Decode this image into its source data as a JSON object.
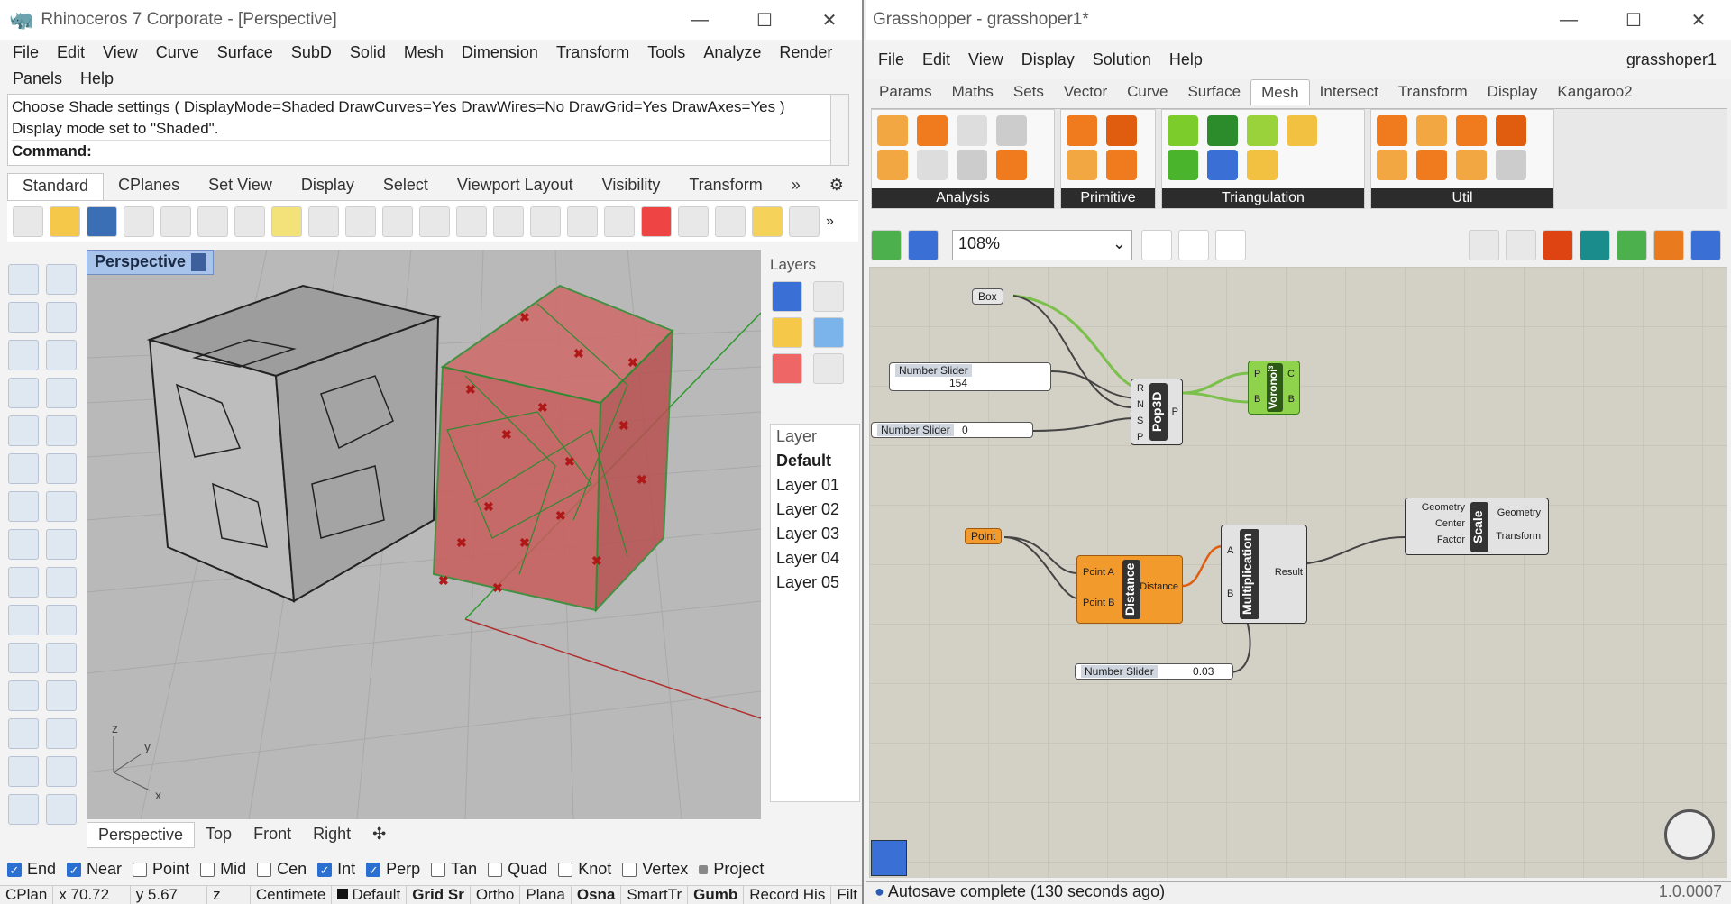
{
  "rhino": {
    "title": "Rhinoceros 7 Corporate - [Perspective]",
    "menu": [
      "File",
      "Edit",
      "View",
      "Curve",
      "Surface",
      "SubD",
      "Solid",
      "Mesh",
      "Dimension",
      "Transform",
      "Tools",
      "Analyze",
      "Render",
      "Panels",
      "Help"
    ],
    "cmd_history": [
      "Choose Shade settings ( DisplayMode=Shaded  DrawCurves=Yes  DrawWires=No  DrawGrid=Yes  DrawAxes=Yes )",
      "Display mode set to \"Shaded\"."
    ],
    "cmd_prompt": "Command:",
    "toolbar_tabs": [
      "Standard",
      "CPlanes",
      "Set View",
      "Display",
      "Select",
      "Viewport Layout",
      "Visibility",
      "Transform"
    ],
    "viewport_title": "Perspective",
    "viewport_tabs": [
      "Perspective",
      "Top",
      "Front",
      "Right"
    ],
    "axis_labels": {
      "z": "z",
      "y": "y",
      "x": "x"
    },
    "layers": {
      "panel_title": "Layers",
      "header": "Layer",
      "items": [
        "Default",
        "Layer 01",
        "Layer 02",
        "Layer 03",
        "Layer 04",
        "Layer 05"
      ]
    },
    "osnaps": [
      {
        "label": "End",
        "on": true
      },
      {
        "label": "Near",
        "on": true
      },
      {
        "label": "Point",
        "on": false
      },
      {
        "label": "Mid",
        "on": false
      },
      {
        "label": "Cen",
        "on": false
      },
      {
        "label": "Int",
        "on": true
      },
      {
        "label": "Perp",
        "on": true
      },
      {
        "label": "Tan",
        "on": false
      },
      {
        "label": "Quad",
        "on": false
      },
      {
        "label": "Knot",
        "on": false
      },
      {
        "label": "Vertex",
        "on": false
      },
      {
        "label": "Project",
        "on": false
      }
    ],
    "status": [
      "CPlan",
      "x 70.72",
      "y 5.67",
      "z",
      "Centimete",
      "Default",
      "Grid Sr",
      "Ortho",
      "Plana",
      "Osna",
      "SmartTr",
      "Gumb",
      "Record His",
      "Filt"
    ]
  },
  "gh": {
    "title": "Grasshopper - grasshoper1*",
    "doc_name": "grasshoper1",
    "menu": [
      "File",
      "Edit",
      "View",
      "Display",
      "Solution",
      "Help"
    ],
    "tabs": [
      "Params",
      "Maths",
      "Sets",
      "Vector",
      "Curve",
      "Surface",
      "Mesh",
      "Intersect",
      "Transform",
      "Display",
      "Kangaroo2"
    ],
    "panels": [
      "Analysis",
      "Primitive",
      "Triangulation",
      "Util"
    ],
    "zoom": "108%",
    "status": "Autosave complete (130 seconds ago)",
    "version": "1.0.0007",
    "nodes": {
      "box": "Box",
      "slider1": {
        "label": "Number Slider",
        "value": "154"
      },
      "slider2": {
        "label": "Number Slider",
        "value": "0"
      },
      "slider3": {
        "label": "Number Slider",
        "value": "0.03"
      },
      "pop3d": {
        "name": "Pop3D",
        "inputs": [
          "R",
          "N",
          "S",
          "P"
        ],
        "output": "P"
      },
      "voronoi": {
        "name": "Voronoi³",
        "inputs": [
          "P",
          "B"
        ],
        "outputs": [
          "C",
          "B"
        ]
      },
      "point": "Point",
      "distance": {
        "name": "Distance",
        "inputs": [
          "Point A",
          "Point B"
        ],
        "output": "Distance"
      },
      "mult": {
        "name": "Multiplication",
        "inputs": [
          "A",
          "B"
        ],
        "output": "Result"
      },
      "scale": {
        "name": "Scale",
        "inputs": [
          "Geometry",
          "Center",
          "Factor"
        ],
        "outputs": [
          "Geometry",
          "Transform"
        ]
      }
    }
  }
}
